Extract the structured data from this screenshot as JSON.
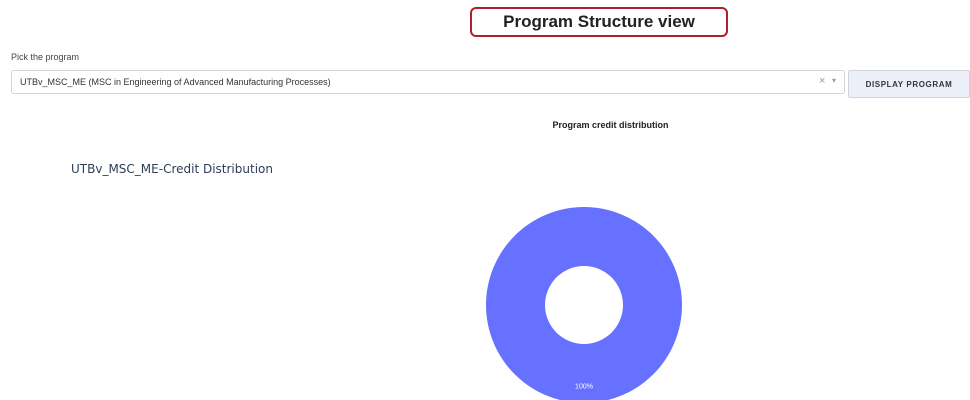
{
  "page": {
    "title": "Program Structure view",
    "pick_label": "Pick the program",
    "selected_program": "UTBv_MSC_ME (MSC in Engineering of Advanced Manufacturing Processes)",
    "clear_glyph": "×",
    "chevron_glyph": "▾",
    "display_button": "DISPLAY PROGRAM",
    "section_heading": "Program credit distribution"
  },
  "colors": {
    "title_border": "#b0202a",
    "slice": "#6672ff"
  },
  "chart_data": {
    "type": "pie",
    "donut": true,
    "title": "UTBv_MSC_ME-Credit Distribution",
    "slices": [
      {
        "label": "",
        "value": 100,
        "display": "100%"
      }
    ]
  }
}
